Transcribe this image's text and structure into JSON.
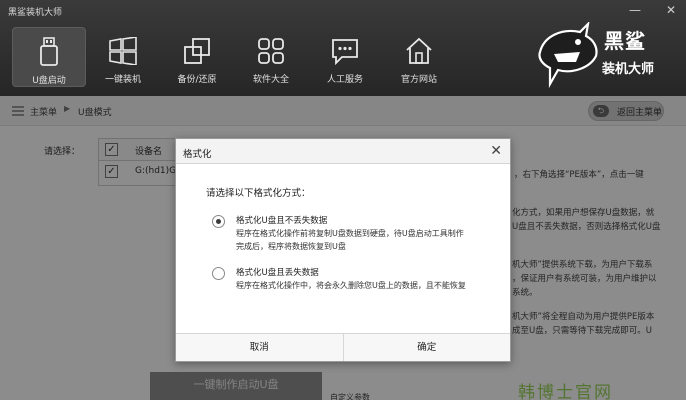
{
  "window": {
    "title": "黑鲨装机大师",
    "minimize": "—",
    "close": "✕"
  },
  "nav": {
    "items": [
      {
        "label": "U盘启动",
        "icon": "usb-icon",
        "active": true
      },
      {
        "label": "一键装机",
        "icon": "windows-icon"
      },
      {
        "label": "备份/还原",
        "icon": "backup-icon"
      },
      {
        "label": "软件大全",
        "icon": "grid-icon"
      },
      {
        "label": "人工服务",
        "icon": "chat-icon"
      },
      {
        "label": "官方网站",
        "icon": "home-icon"
      }
    ]
  },
  "logo": {
    "line1": "黑鲨",
    "line2": "装机大师",
    "icon": "shark-logo-icon"
  },
  "breadcrumb": {
    "root": "主菜单",
    "current": "U盘模式",
    "back_label": "返回主菜单"
  },
  "content": {
    "select_label": "请选择：",
    "table_header": "设备名",
    "table_row": "G:(hd1)G",
    "right_lines": [
      "，右下角选择“PE版本”，点击一键",
      "化方式，如果用户想保存U盘数据，就",
      "U盘且不丢失数据，否则选择格式化U盘",
      "机大师”提供系统下载，为用户下载系",
      "，保证用户有系统可装，为用户维护以",
      "系统。",
      "机大师”将全程自动为用户提供PE版本",
      "成至U盘，只需等待下载完成即可。U"
    ],
    "make_button": "一键制作启动U盘",
    "custom_param": "自定义参数",
    "watermark": "韩博士官网"
  },
  "dialog": {
    "title": "格式化",
    "prompt": "请选择以下格式化方式：",
    "options": [
      {
        "title": "格式化U盘且不丢失数据",
        "desc1": "程序在格式化操作前将复制U盘数据到硬盘，待U盘启动工具制作",
        "desc2": "完成后，程序将数据恢复到U盘",
        "selected": true
      },
      {
        "title": "格式化U盘且丢失数据",
        "desc1": "程序在格式化操作中，将会永久删除您U盘上的数据，且不能恢复",
        "desc2": "",
        "selected": false
      }
    ],
    "cancel": "取消",
    "confirm": "确定"
  },
  "colors": {
    "header": "#2e2e2e",
    "watermark": "#8fd24a"
  }
}
